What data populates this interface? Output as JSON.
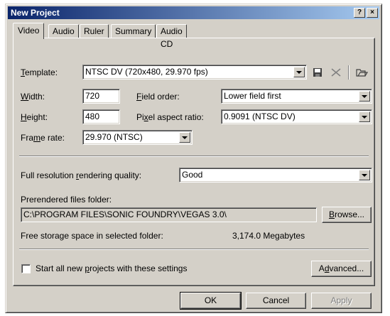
{
  "window": {
    "title": "New Project",
    "help_button": "?",
    "close_button": "×"
  },
  "tabs": [
    {
      "label": "Video",
      "active": true
    },
    {
      "label": "Audio",
      "active": false
    },
    {
      "label": "Ruler",
      "active": false
    },
    {
      "label": "Summary",
      "active": false
    },
    {
      "label": "Audio CD",
      "active": false
    }
  ],
  "template": {
    "label_key": "T",
    "label_rest": "emplate:",
    "value": "NTSC DV (720x480, 29.970 fps)",
    "save_icon": "save-icon",
    "delete_icon": "delete-icon",
    "open_icon": "open-folder-icon"
  },
  "width": {
    "label_key": "W",
    "label_rest": "idth:",
    "value": "720"
  },
  "height": {
    "label_key": "H",
    "label_rest": "eight:",
    "value": "480"
  },
  "field_order": {
    "label_key": "F",
    "label_rest": "ield order:",
    "value": "Lower field first"
  },
  "pixel_aspect": {
    "label_pre": "Pi",
    "label_key": "x",
    "label_rest": "el aspect ratio:",
    "value": "0.9091 (NTSC DV)"
  },
  "frame_rate": {
    "label_pre": "Fra",
    "label_key": "m",
    "label_rest": "e rate:",
    "value": "29.970 (NTSC)"
  },
  "render_quality": {
    "label_pre": "Full resolution ",
    "label_key": "r",
    "label_rest": "endering quality:",
    "value": "Good"
  },
  "prerendered": {
    "label": "Prerendered files folder:",
    "value": "C:\\PROGRAM FILES\\SONIC FOUNDRY\\VEGAS 3.0\\",
    "browse_key": "B",
    "browse_rest": "rowse..."
  },
  "storage": {
    "label": "Free storage space in selected folder:",
    "value": "3,174.0 Megabytes"
  },
  "start_new": {
    "label_pre": "Start all new ",
    "label_key": "p",
    "label_rest": "rojects with these settings",
    "checked": false
  },
  "advanced": {
    "label_pre": "A",
    "label_key": "d",
    "label_rest": "vanced..."
  },
  "buttons": {
    "ok": "OK",
    "cancel": "Cancel",
    "apply": "Apply"
  }
}
